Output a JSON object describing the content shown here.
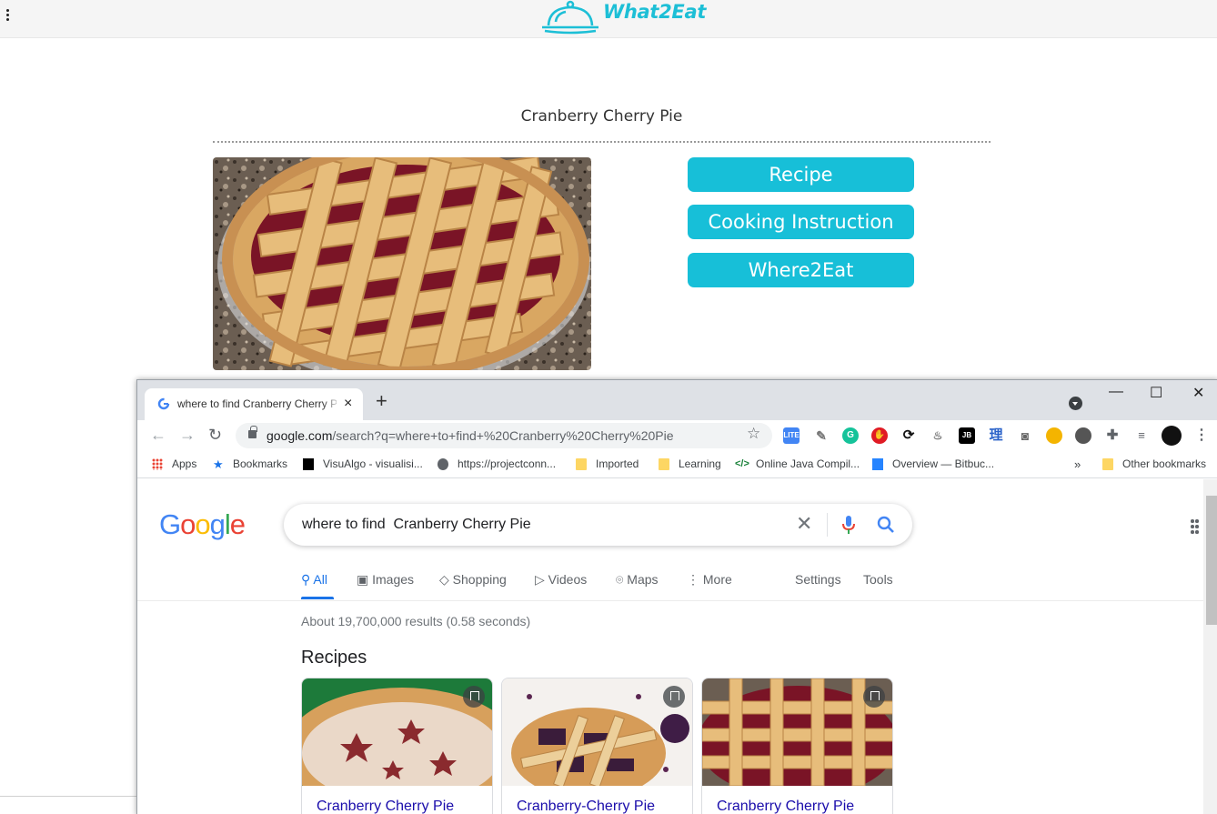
{
  "app": {
    "brand": "What2Eat",
    "dish_title": "Cranberry Cherry Pie",
    "buttons": {
      "recipe": "Recipe",
      "cooking": "Cooking Instruction",
      "where": "Where2Eat"
    },
    "accent_color": "#17bfd8"
  },
  "browser": {
    "tab_title": "where to find Cranberry Cherry Pie",
    "tab_close": "×",
    "new_tab": "+",
    "url_host": "google.com",
    "url_path": "/search?q=where+to+find+%20Cranberry%20Cherry%20Pie",
    "window_controls": {
      "minimize": "—",
      "maximize": "☐",
      "close": "✕"
    },
    "extensions": [
      "lite-icon",
      "grammar-icon",
      "grammarly-icon",
      "adblock-icon",
      "sync-icon",
      "java-icon",
      "jetbrains-icon",
      "dictionary-icon",
      "camera-icon",
      "colorpick-icon",
      "dark-icon",
      "puzzle-icon",
      "media-icon",
      "profile-avatar",
      "more-icon"
    ],
    "bookmarks": [
      {
        "label": "Apps",
        "icon": "apps-grid-icon"
      },
      {
        "label": "Bookmarks",
        "icon": "star-icon"
      },
      {
        "label": "VisuAlgo - visualisi...",
        "icon": "visualgo-icon"
      },
      {
        "label": "https://projectconn...",
        "icon": "globe-icon"
      },
      {
        "label": "Imported",
        "icon": "folder-icon"
      },
      {
        "label": "Learning",
        "icon": "folder-icon"
      },
      {
        "label": "Online Java Compil...",
        "icon": "code-icon"
      },
      {
        "label": "Overview — Bitbuc...",
        "icon": "bitbucket-icon"
      }
    ],
    "bookmarks_overflow": "»",
    "other_bookmarks": "Other bookmarks"
  },
  "google": {
    "logo": [
      "G",
      "o",
      "o",
      "g",
      "l",
      "e"
    ],
    "logo_colors": [
      "#4285f4",
      "#ea4335",
      "#fbbc05",
      "#4285f4",
      "#34a853",
      "#ea4335"
    ],
    "query": "where to find  Cranberry Cherry Pie",
    "tabs": [
      "All",
      "Images",
      "Shopping",
      "Videos",
      "Maps",
      "More"
    ],
    "settings": "Settings",
    "tools": "Tools",
    "stats": "About 19,700,000 results (0.58 seconds)",
    "section_heading": "Recipes",
    "cards": [
      {
        "title": "Cranberry Cherry Pie"
      },
      {
        "title": "Cranberry-Cherry Pie"
      },
      {
        "title": "Cranberry Cherry Pie"
      }
    ]
  }
}
